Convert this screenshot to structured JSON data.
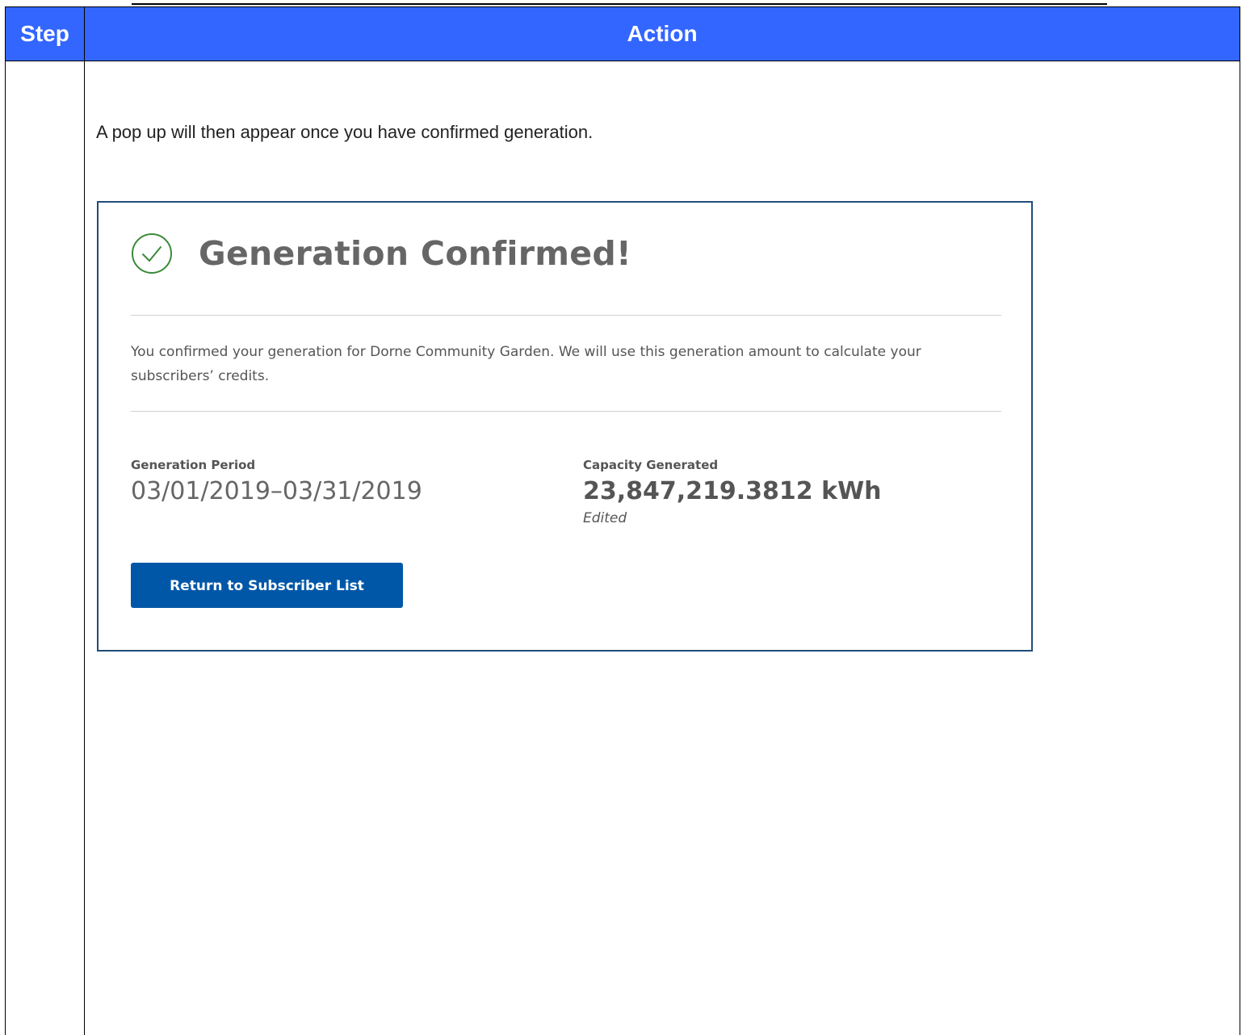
{
  "table": {
    "headers": {
      "step": "Step",
      "action": "Action"
    },
    "row": {
      "step": "",
      "intro_text": "A pop up will then appear once you have confirmed generation."
    }
  },
  "modal": {
    "icon": "check-circle-icon",
    "title": "Generation Confirmed!",
    "body": "You confirmed your generation for Dorne Community Garden. We will use this generation amount to calculate your subscribers’ credits.",
    "generation_period": {
      "label": "Generation Period",
      "value": "03/01/2019–03/31/2019"
    },
    "capacity_generated": {
      "label": "Capacity Generated",
      "value": "23,847,219.3812 kWh",
      "note": "Edited"
    },
    "button_label": "Return to Subscriber List"
  },
  "colors": {
    "header_bg": "#3366ff",
    "modal_border": "#1f4e79",
    "success_green": "#3a8a3a",
    "button_bg": "#0057a8"
  }
}
